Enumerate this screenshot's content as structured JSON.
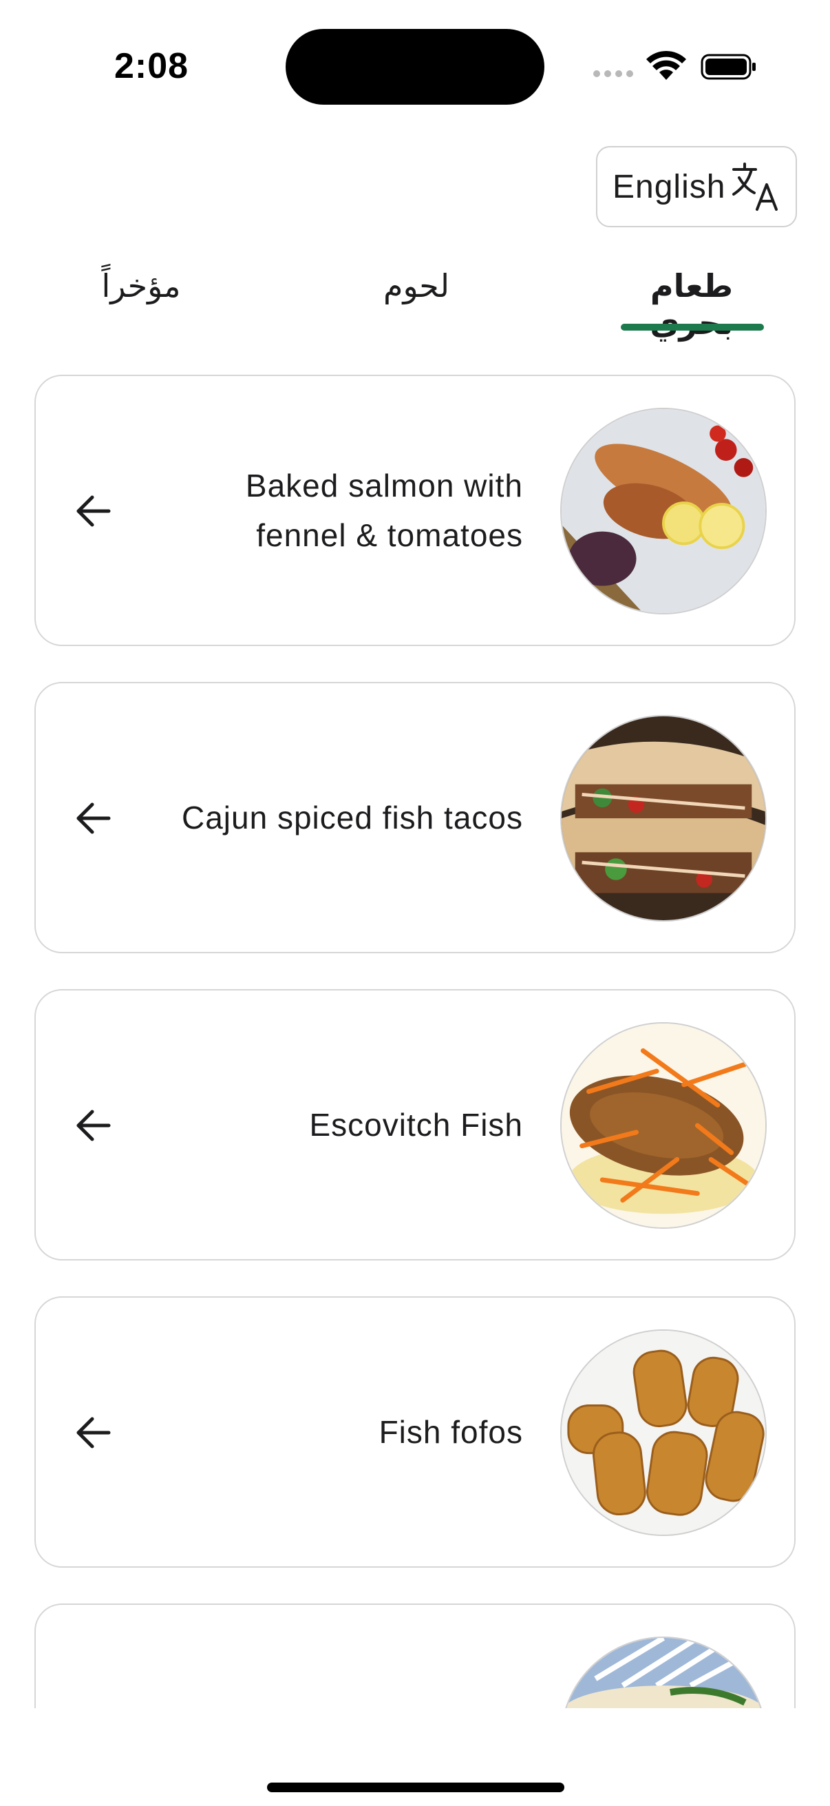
{
  "status_bar": {
    "time": "2:08"
  },
  "language_toggle": {
    "label": "English",
    "icon": "translate-icon"
  },
  "tabs": [
    {
      "label": "طعام بحري",
      "selected": true
    },
    {
      "label": "لحوم",
      "selected": false
    },
    {
      "label": "مؤخراً",
      "selected": false
    }
  ],
  "accent_color": "#1d7a4d",
  "recipes": [
    {
      "title": "Baked salmon with fennel & tomatoes",
      "image": "baked-salmon-image"
    },
    {
      "title": "Cajun spiced fish tacos",
      "image": "fish-tacos-image"
    },
    {
      "title": "Escovitch Fish",
      "image": "escovitch-fish-image"
    },
    {
      "title": "Fish fofos",
      "image": "fish-fofos-image"
    },
    {
      "title": "",
      "image": "partial-dish-image"
    }
  ]
}
